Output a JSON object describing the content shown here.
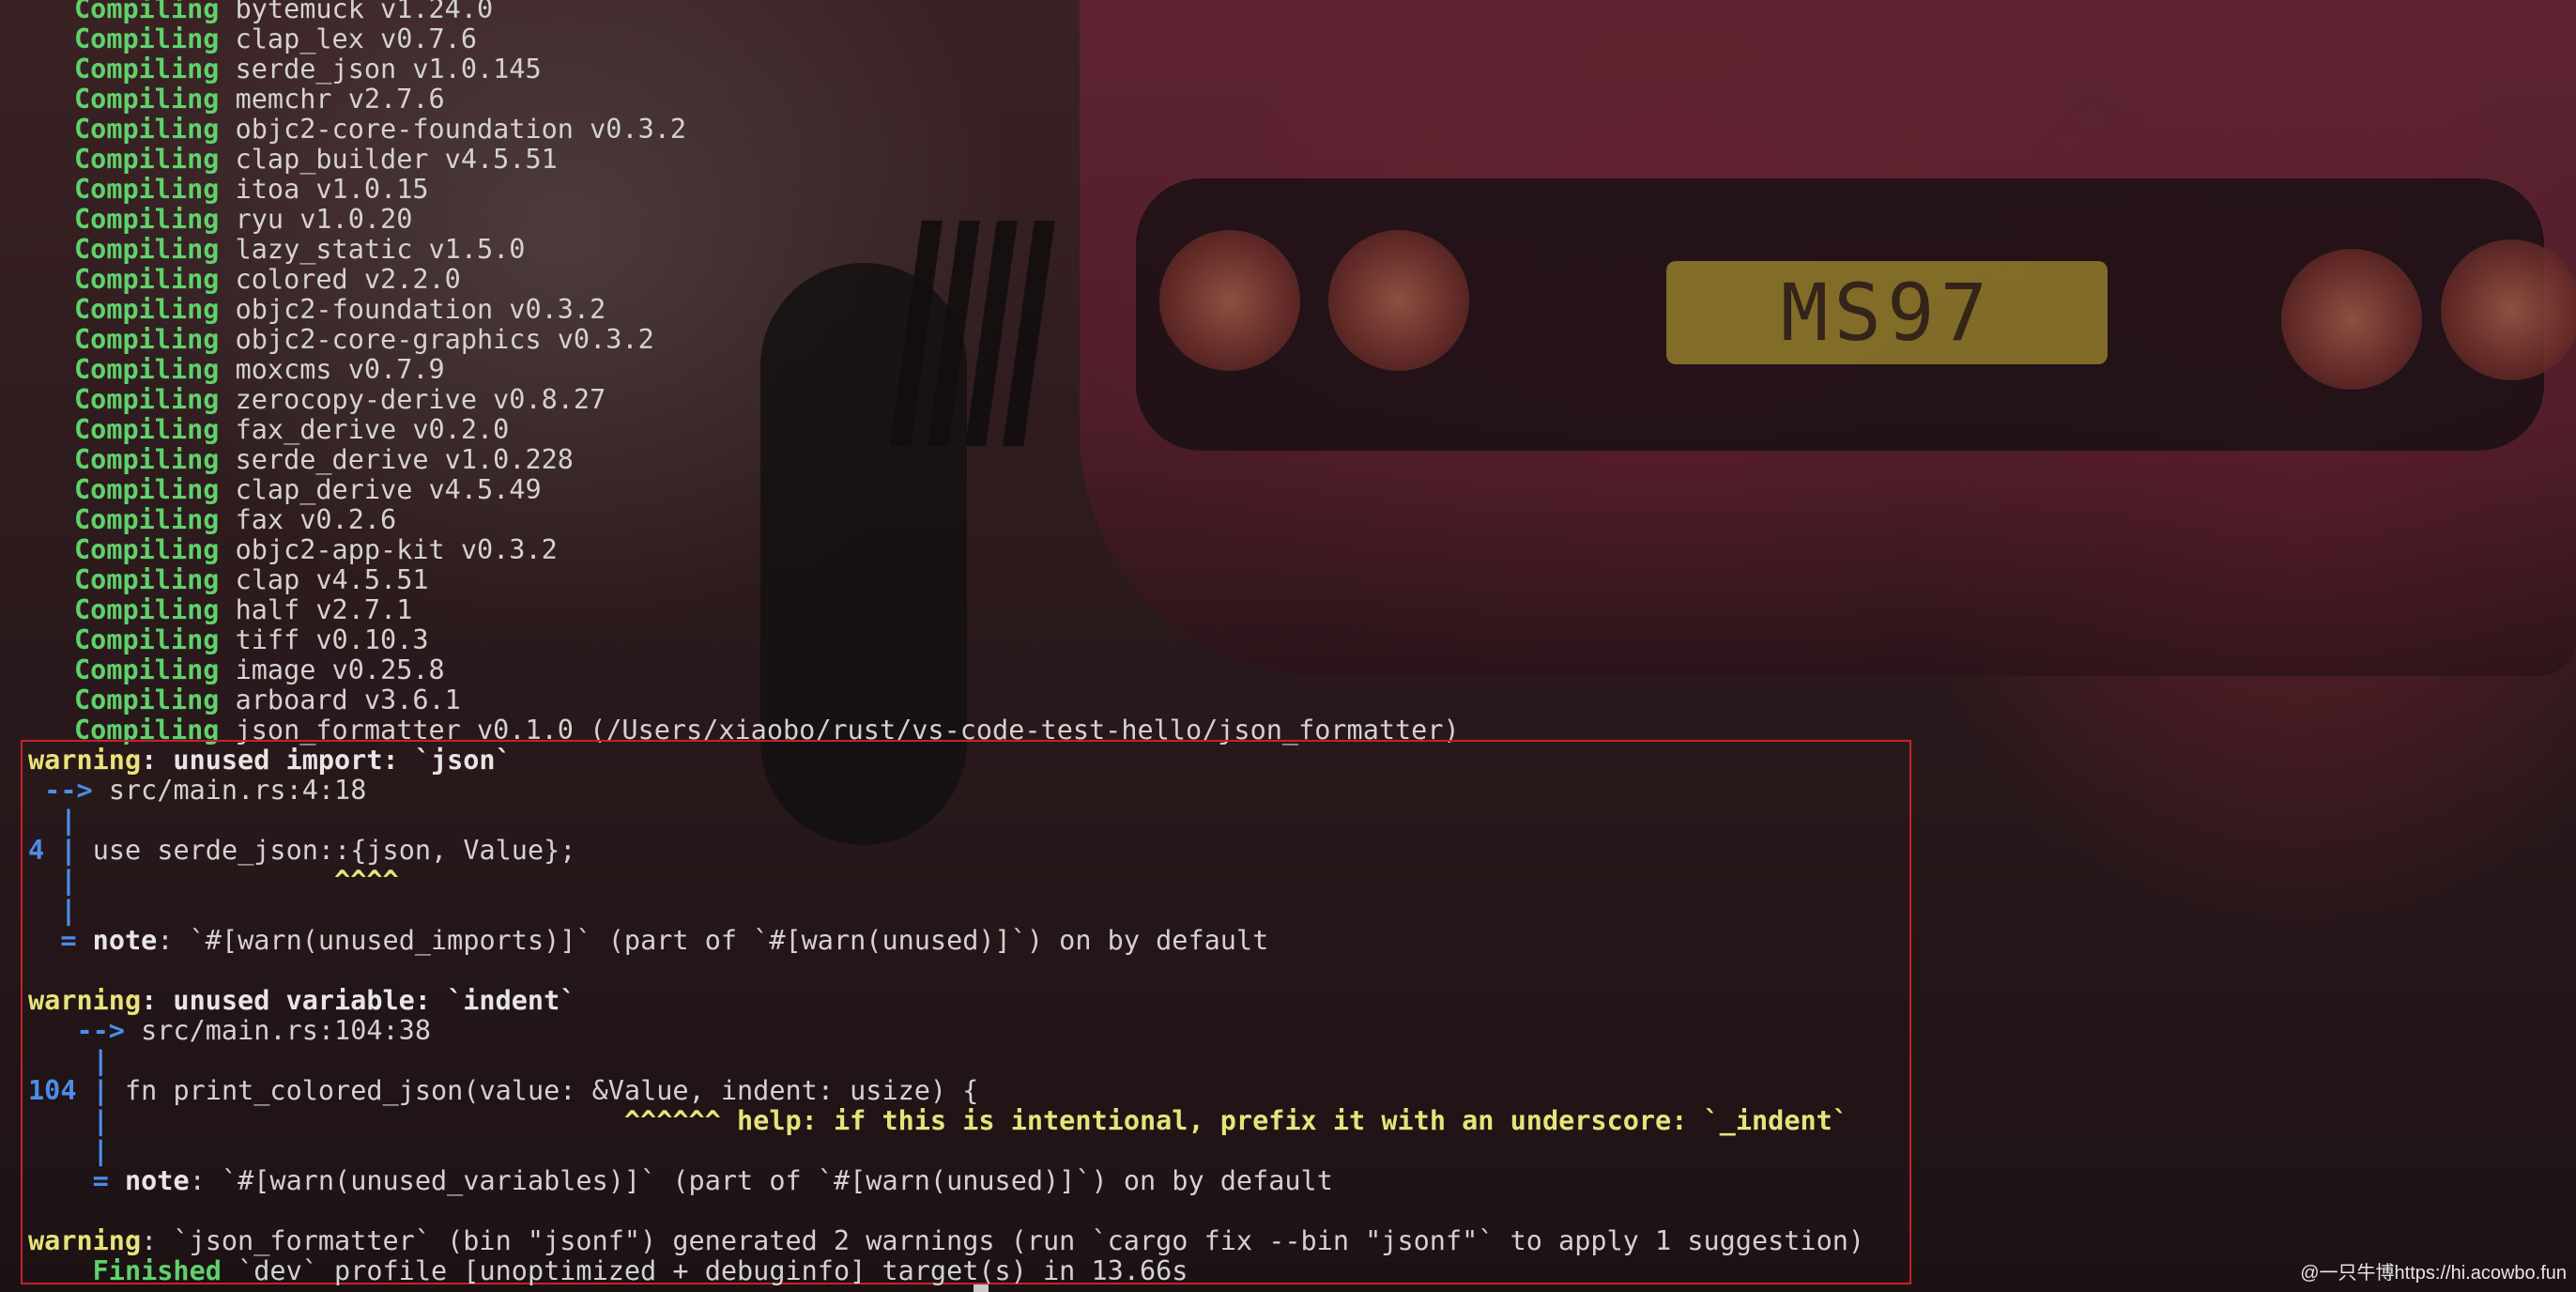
{
  "background": {
    "plate_text": "MS97"
  },
  "compile_lines": [
    {
      "kw": "Compiling",
      "text": "bytemuck v1.24.0"
    },
    {
      "kw": "Compiling",
      "text": "clap_lex v0.7.6"
    },
    {
      "kw": "Compiling",
      "text": "serde_json v1.0.145"
    },
    {
      "kw": "Compiling",
      "text": "memchr v2.7.6"
    },
    {
      "kw": "Compiling",
      "text": "objc2-core-foundation v0.3.2"
    },
    {
      "kw": "Compiling",
      "text": "clap_builder v4.5.51"
    },
    {
      "kw": "Compiling",
      "text": "itoa v1.0.15"
    },
    {
      "kw": "Compiling",
      "text": "ryu v1.0.20"
    },
    {
      "kw": "Compiling",
      "text": "lazy_static v1.5.0"
    },
    {
      "kw": "Compiling",
      "text": "colored v2.2.0"
    },
    {
      "kw": "Compiling",
      "text": "objc2-foundation v0.3.2"
    },
    {
      "kw": "Compiling",
      "text": "objc2-core-graphics v0.3.2"
    },
    {
      "kw": "Compiling",
      "text": "moxcms v0.7.9"
    },
    {
      "kw": "Compiling",
      "text": "zerocopy-derive v0.8.27"
    },
    {
      "kw": "Compiling",
      "text": "fax_derive v0.2.0"
    },
    {
      "kw": "Compiling",
      "text": "serde_derive v1.0.228"
    },
    {
      "kw": "Compiling",
      "text": "clap_derive v4.5.49"
    },
    {
      "kw": "Compiling",
      "text": "fax v0.2.6"
    },
    {
      "kw": "Compiling",
      "text": "objc2-app-kit v0.3.2"
    },
    {
      "kw": "Compiling",
      "text": "clap v4.5.51"
    },
    {
      "kw": "Compiling",
      "text": "half v2.7.1"
    },
    {
      "kw": "Compiling",
      "text": "tiff v0.10.3"
    },
    {
      "kw": "Compiling",
      "text": "image v0.25.8"
    },
    {
      "kw": "Compiling",
      "text": "arboard v3.6.1"
    },
    {
      "kw": "Compiling",
      "text": "json_formatter v0.1.0 (/Users/xiaobo/rust/vs-code-test-hello/json_formatter)"
    }
  ],
  "warning1": {
    "label": "warning",
    "message": ": unused import: `json`",
    "arrow": "-->",
    "location": "src/main.rs:4:18",
    "pipe": "|",
    "line_no": "4",
    "code": "use serde_json::{json, Value};",
    "carets": "^^^^",
    "note_eq": "=",
    "note_label": "note",
    "note_text": ": `#[warn(unused_imports)]` (part of `#[warn(unused)]`) on by default"
  },
  "warning2": {
    "label": "warning",
    "message": ": unused variable: `indent`",
    "arrow": "-->",
    "location": "src/main.rs:104:38",
    "pipe": "|",
    "line_no": "104",
    "code": "fn print_colored_json(value: &Value, indent: usize) {",
    "carets": "^^^^^^",
    "help": "help: if this is intentional, prefix it with an underscore: `_indent`",
    "note_eq": "=",
    "note_label": "note",
    "note_text": ": `#[warn(unused_variables)]` (part of `#[warn(unused)]`) on by default"
  },
  "summary": {
    "label": "warning",
    "text": ": `json_formatter` (bin \"jsonf\") generated 2 warnings (run `cargo fix --bin \"jsonf\"` to apply 1 suggestion)"
  },
  "finished": {
    "kw": "Finished",
    "text": "`dev` profile [unoptimized + debuginfo] target(s) in 13.66s"
  },
  "watermark": "@一只牛博https://hi.acowbo.fun",
  "colors": {
    "green": "#5fd26b",
    "yellow": "#e8e37a",
    "blue": "#4b8de8",
    "highlight_border": "#c8202a"
  }
}
